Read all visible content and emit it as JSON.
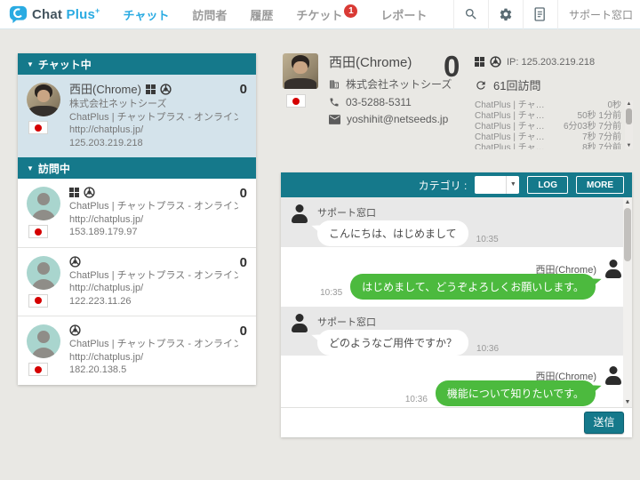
{
  "colors": {
    "accent_teal": "#15798b",
    "brand_blue": "#2aabe2",
    "badge_red": "#d93a35",
    "bubble_green": "#4cba3e",
    "selected_item_bg": "#d4e3eb",
    "page_bg": "#e9e8e4"
  },
  "nav": {
    "logo": {
      "part1": "Chat",
      "part2": "Plus",
      "sup": "+"
    },
    "items": [
      {
        "label": "チャット"
      },
      {
        "label": "訪問者"
      },
      {
        "label": "履歴"
      },
      {
        "label": "チケット",
        "badge": "1"
      },
      {
        "label": "レポート"
      }
    ],
    "user_label": "サポート窓口",
    "icons": [
      "search-icon",
      "gear-icon",
      "document-icon"
    ]
  },
  "sidebar": {
    "section_chatting": {
      "title": "チャット中",
      "item": {
        "name": "西田(Chrome)",
        "company": "株式会社ネットシーズ",
        "page_title": "ChatPlus | チャットプラス - オンラインチャットサポ…",
        "url": "http://chatplus.jp/",
        "ip": "125.203.219.218",
        "count": "0"
      }
    },
    "section_visiting": {
      "title": "訪問中",
      "items": [
        {
          "page_title": "ChatPlus | チャットプラス - オンラインチャットサポ…",
          "url": "http://chatplus.jp/",
          "ip": "153.189.179.97",
          "count": "0"
        },
        {
          "page_title": "ChatPlus | チャットプラス - オンラインチャットサポ…",
          "url": "http://chatplus.jp/",
          "ip": "122.223.11.26",
          "count": "0"
        },
        {
          "page_title": "ChatPlus | チャットプラス - オンラインチャットサポ…",
          "url": "http://chatplus.jp/",
          "ip": "182.20.138.5",
          "count": "0"
        }
      ]
    }
  },
  "detail": {
    "name": "西田(Chrome)",
    "company": "株式会社ネットシーズ",
    "phone": "03-5288-5311",
    "email": "yoshihit@netseeds.jp",
    "unread_count": "0",
    "ip": "IP: 125.203.219.218",
    "visits": "61回訪問",
    "history": [
      {
        "title": "ChatPlus | チャ…",
        "time": "0秒"
      },
      {
        "title": "ChatPlus | チャ…",
        "time": "50秒 1分前"
      },
      {
        "title": "ChatPlus | チャ…",
        "time": "6分03秒 7分前"
      },
      {
        "title": "ChatPlus | チャ…",
        "time": "7秒 7分前"
      },
      {
        "title": "ChatPlus | チャ…",
        "time": "8秒 7分前"
      }
    ]
  },
  "chat": {
    "header": {
      "category_label": "カテゴリ :",
      "log": "LOG",
      "more": "MORE"
    },
    "messages": [
      {
        "side": "left",
        "sender": "サポート窓口",
        "text": "こんにちは、はじめまして",
        "time": "10:35"
      },
      {
        "side": "right",
        "sender": "西田(Chrome)",
        "text": "はじめまして、どうぞよろしくお願いします。",
        "time": "10:35"
      },
      {
        "side": "left",
        "sender": "サポート窓口",
        "text": "どのようなご用件ですか？",
        "time": "10:36"
      },
      {
        "side": "right",
        "sender": "西田(Chrome)",
        "text": "機能について知りたいです。",
        "time": "10:36"
      }
    ],
    "send_label": "送信"
  }
}
